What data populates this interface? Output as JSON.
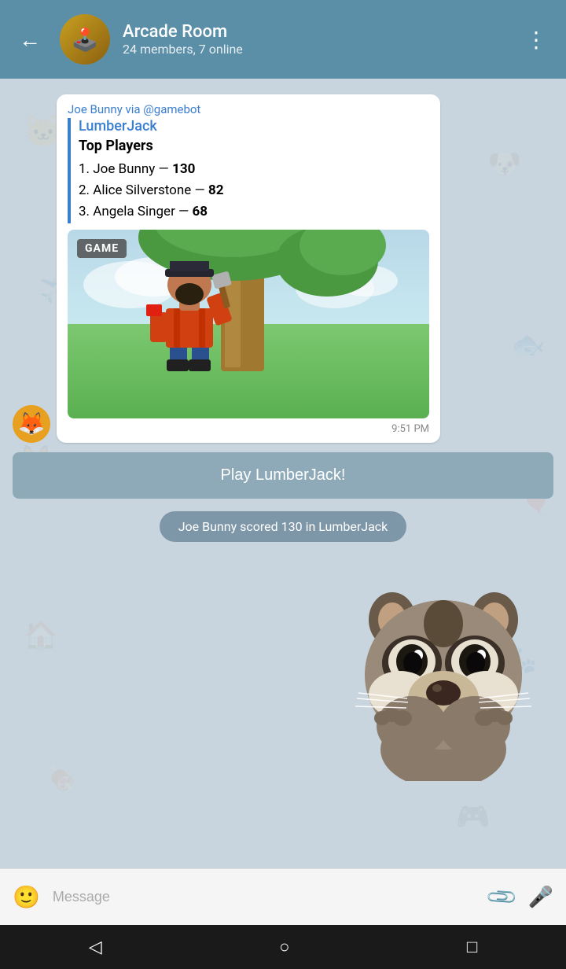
{
  "header": {
    "title": "Arcade Room",
    "subtitle": "24 members, 7 online",
    "back_label": "←",
    "more_label": "⋮"
  },
  "message": {
    "sender_line": "Joe Bunny via @gamebot",
    "game_name": "LumberJack",
    "score_title": "Top Players",
    "players": [
      {
        "rank": "1.",
        "name": "Joe Bunny",
        "separator": "—",
        "score": "130"
      },
      {
        "rank": "2.",
        "name": "Alice Silverstone",
        "separator": "—",
        "score": "82"
      },
      {
        "rank": "3.",
        "name": "Angela Singer",
        "separator": "—",
        "score": "68"
      }
    ],
    "game_label": "GAME",
    "time": "9:51 PM"
  },
  "play_button": {
    "label": "Play LumberJack!"
  },
  "score_notification": {
    "text": "Joe Bunny scored 130 in LumberJack"
  },
  "input": {
    "placeholder": "Message"
  },
  "nav": {
    "back": "◁",
    "home": "○",
    "recent": "□"
  }
}
